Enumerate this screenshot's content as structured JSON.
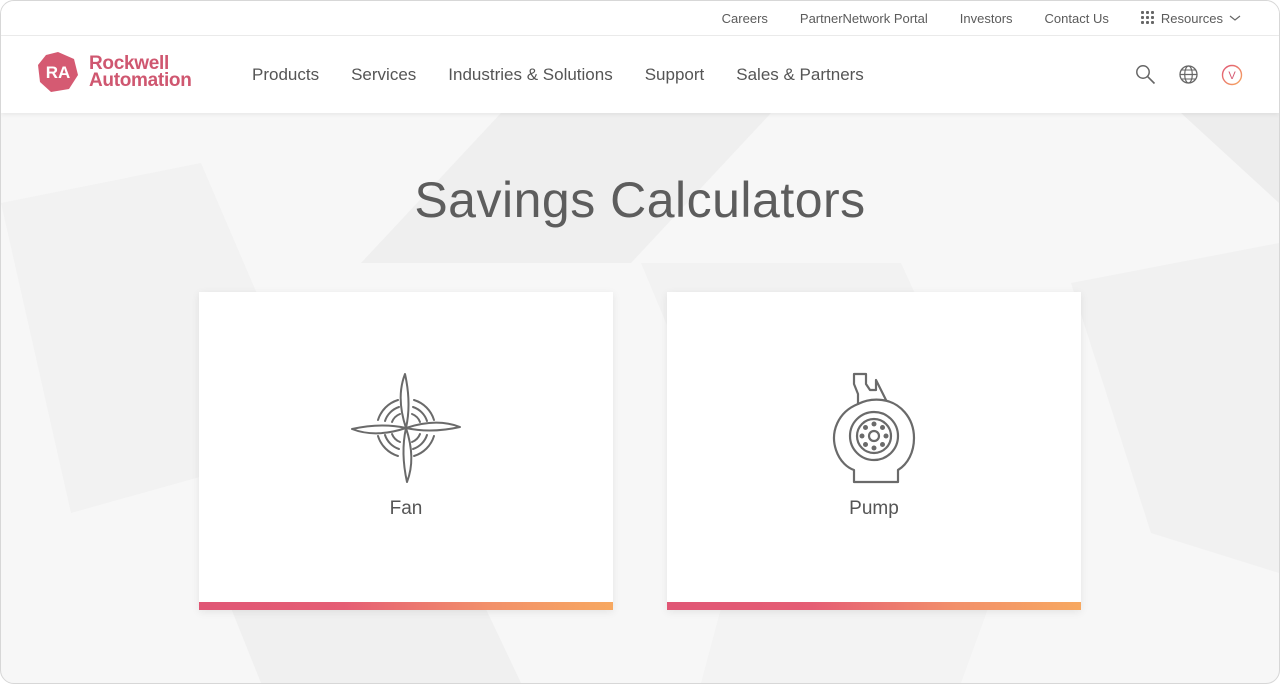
{
  "utility_nav": {
    "links": [
      "Careers",
      "PartnerNetwork Portal",
      "Investors",
      "Contact Us"
    ],
    "resources_label": "Resources"
  },
  "header": {
    "logo": {
      "monogram": "RA",
      "line1": "Rockwell",
      "line2": "Automation"
    },
    "nav_items": [
      "Products",
      "Services",
      "Industries & Solutions",
      "Support",
      "Sales & Partners"
    ],
    "icons": [
      "search-icon",
      "globe-icon",
      "user-avatar-icon"
    ],
    "avatar_initial": "V"
  },
  "main": {
    "title": "Savings Calculators",
    "cards": [
      {
        "label": "Fan",
        "icon": "fan-icon"
      },
      {
        "label": "Pump",
        "icon": "pump-icon"
      }
    ]
  },
  "colors": {
    "brand": "#cf5770",
    "gradient_start": "#e05675",
    "gradient_end": "#f7a860",
    "text": "#5d5d5d"
  }
}
